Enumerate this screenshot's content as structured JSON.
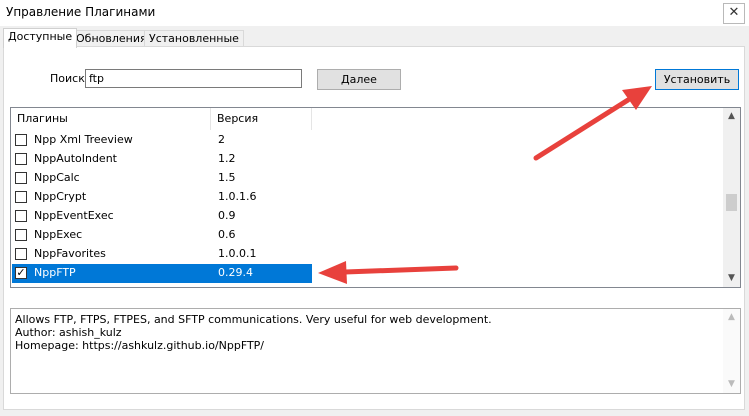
{
  "window": {
    "title": "Управление Плагинами",
    "close_glyph": "✕"
  },
  "tabs": [
    {
      "label": "Доступные",
      "active": true
    },
    {
      "label": "Обновления",
      "active": false
    },
    {
      "label": "Установленные",
      "active": false
    }
  ],
  "search": {
    "label": "Поиск:",
    "value": "ftp"
  },
  "buttons": {
    "next": "Далее",
    "install": "Установить"
  },
  "list": {
    "columns": [
      "Плагины",
      "Версия"
    ],
    "rows": [
      {
        "name": "Npp Xml Treeview",
        "version": "2",
        "checked": false,
        "selected": false
      },
      {
        "name": "NppAutoIndent",
        "version": "1.2",
        "checked": false,
        "selected": false
      },
      {
        "name": "NppCalc",
        "version": "1.5",
        "checked": false,
        "selected": false
      },
      {
        "name": "NppCrypt",
        "version": "1.0.1.6",
        "checked": false,
        "selected": false
      },
      {
        "name": "NppEventExec",
        "version": "0.9",
        "checked": false,
        "selected": false
      },
      {
        "name": "NppExec",
        "version": "0.6",
        "checked": false,
        "selected": false
      },
      {
        "name": "NppFavorites",
        "version": "1.0.0.1",
        "checked": false,
        "selected": false
      },
      {
        "name": "NppFTP",
        "version": "0.29.4",
        "checked": true,
        "selected": true
      }
    ]
  },
  "description": {
    "lines": [
      "Allows FTP, FTPS, FTPES, and SFTP communications. Very useful for web development.",
      "Author: ashish_kulz",
      "Homepage: https://ashkulz.github.io/NppFTP/"
    ]
  },
  "colors": {
    "selection": "#0078d7",
    "annotation_arrow": "#e8413c"
  }
}
